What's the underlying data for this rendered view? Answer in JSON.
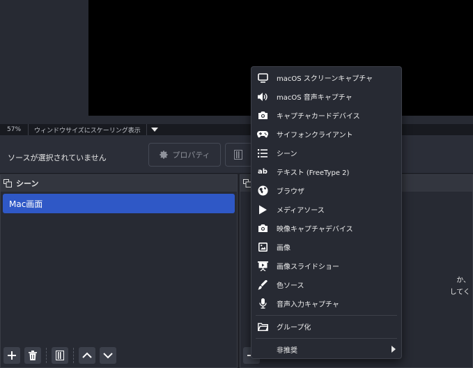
{
  "status": {
    "zoom": "57%",
    "scale_mode": "ウィンドウサイズにスケーリング表示"
  },
  "source_bar": {
    "no_source": "ソースが選択されていません",
    "properties": "プロパティ"
  },
  "scenes": {
    "title": "シーン",
    "items": [
      "Mac画面"
    ]
  },
  "sources": {
    "hint_line1": "か、",
    "hint_line2": "してく"
  },
  "menu": {
    "items": [
      {
        "label": "macOS スクリーンキャプチャ",
        "icon": "monitor-icon"
      },
      {
        "label": "macOS 音声キャプチャ",
        "icon": "speaker-icon"
      },
      {
        "label": "キャプチャカードデバイス",
        "icon": "camera-icon"
      },
      {
        "label": "サイフォンクライアント",
        "icon": "gamepad-icon"
      },
      {
        "label": "シーン",
        "icon": "list-icon"
      },
      {
        "label": "テキスト (FreeType 2)",
        "icon": "text-ab-icon"
      },
      {
        "label": "ブラウザ",
        "icon": "globe-icon"
      },
      {
        "label": "メディアソース",
        "icon": "play-icon"
      },
      {
        "label": "映像キャプチャデバイス",
        "icon": "camera-icon"
      },
      {
        "label": "画像",
        "icon": "image-icon"
      },
      {
        "label": "画像スライドショー",
        "icon": "slideshow-icon"
      },
      {
        "label": "色ソース",
        "icon": "brush-icon"
      },
      {
        "label": "音声入力キャプチャ",
        "icon": "microphone-icon"
      }
    ],
    "group": {
      "label": "グループ化",
      "icon": "folder-icon"
    },
    "deprecated": {
      "label": "非推奨"
    }
  }
}
